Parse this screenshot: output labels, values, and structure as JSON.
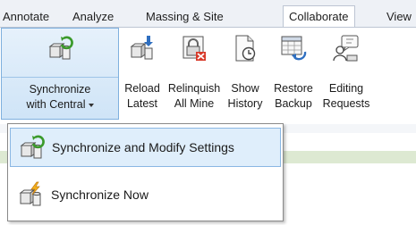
{
  "tabs": [
    "Annotate",
    "Analyze",
    "Massing & Site",
    "Collaborate",
    "View"
  ],
  "active_tab": "Collaborate",
  "ribbon": {
    "buttons": [
      {
        "line1": "Synchronize",
        "line2": "with Central",
        "icon": "sync-central-icon"
      },
      {
        "line1": "Reload",
        "line2": "Latest",
        "icon": "reload-latest-icon"
      },
      {
        "line1": "Relinquish",
        "line2": "All Mine",
        "icon": "relinquish-icon"
      },
      {
        "line1": "Show",
        "line2": "History",
        "icon": "show-history-icon"
      },
      {
        "line1": "Restore",
        "line2": "Backup",
        "icon": "restore-backup-icon"
      },
      {
        "line1": "Editing",
        "line2": "Requests",
        "icon": "editing-requests-icon"
      }
    ]
  },
  "menu": {
    "items": [
      {
        "label": "Synchronize and Modify Settings",
        "icon": "sync-modify-icon",
        "highlighted": true
      },
      {
        "label": "Synchronize Now",
        "icon": "sync-now-icon",
        "highlighted": false
      }
    ]
  },
  "colors": {
    "highlight_fill": "#dfeefb",
    "highlight_border": "#8ab7e3",
    "green_strip": "#dde9d2"
  }
}
